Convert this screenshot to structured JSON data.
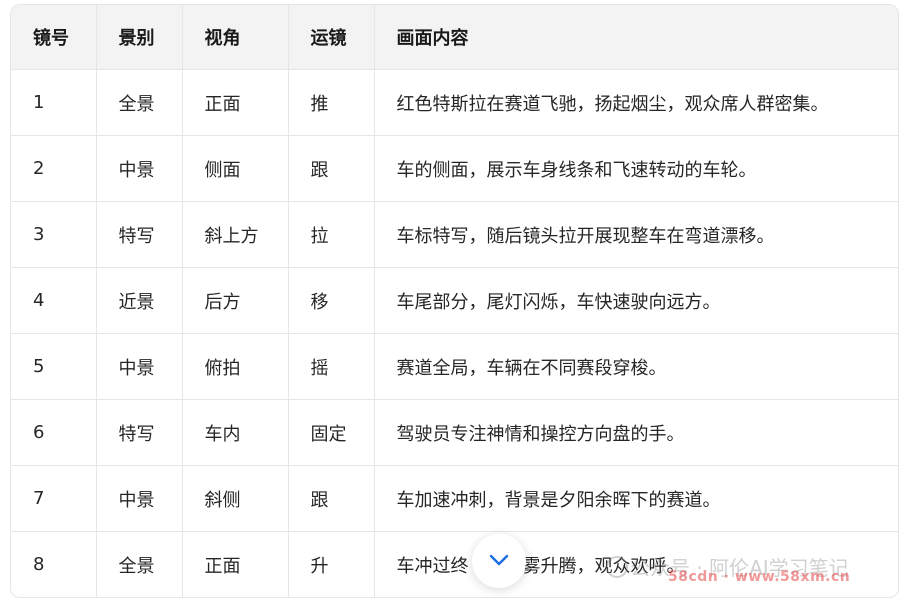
{
  "table": {
    "headers": [
      "镜号",
      "景别",
      "视角",
      "运镜",
      "画面内容"
    ],
    "rows": [
      [
        "1",
        "全景",
        "正面",
        "推",
        "红色特斯拉在赛道飞驰，扬起烟尘，观众席人群密集。"
      ],
      [
        "2",
        "中景",
        "侧面",
        "跟",
        "车的侧面，展示车身线条和飞速转动的车轮。"
      ],
      [
        "3",
        "特写",
        "斜上方",
        "拉",
        "车标特写，随后镜头拉开展现整车在弯道漂移。"
      ],
      [
        "4",
        "近景",
        "后方",
        "移",
        "车尾部分，尾灯闪烁，车快速驶向远方。"
      ],
      [
        "5",
        "中景",
        "俯拍",
        "摇",
        "赛道全局，车辆在不同赛段穿梭。"
      ],
      [
        "6",
        "特写",
        "车内",
        "固定",
        "驾驶员专注神情和操控方向盘的手。"
      ],
      [
        "7",
        "中景",
        "斜侧",
        "跟",
        "车加速冲刺，背景是夕阳余晖下的赛道。"
      ],
      [
        "8",
        "全景",
        "正面",
        "升",
        "车冲过终　　烟雾升腾，观众欢呼。"
      ]
    ]
  },
  "scroll_button": {
    "icon": "chevron-down-icon"
  },
  "watermark": {
    "text": "公众号 · 阿伦AI学习笔记",
    "site": "58cdn · www.58xm.cn"
  },
  "colors": {
    "header_bg": "#f3f3f3",
    "border": "#e6e6e6",
    "chevron": "#1a6de0"
  }
}
